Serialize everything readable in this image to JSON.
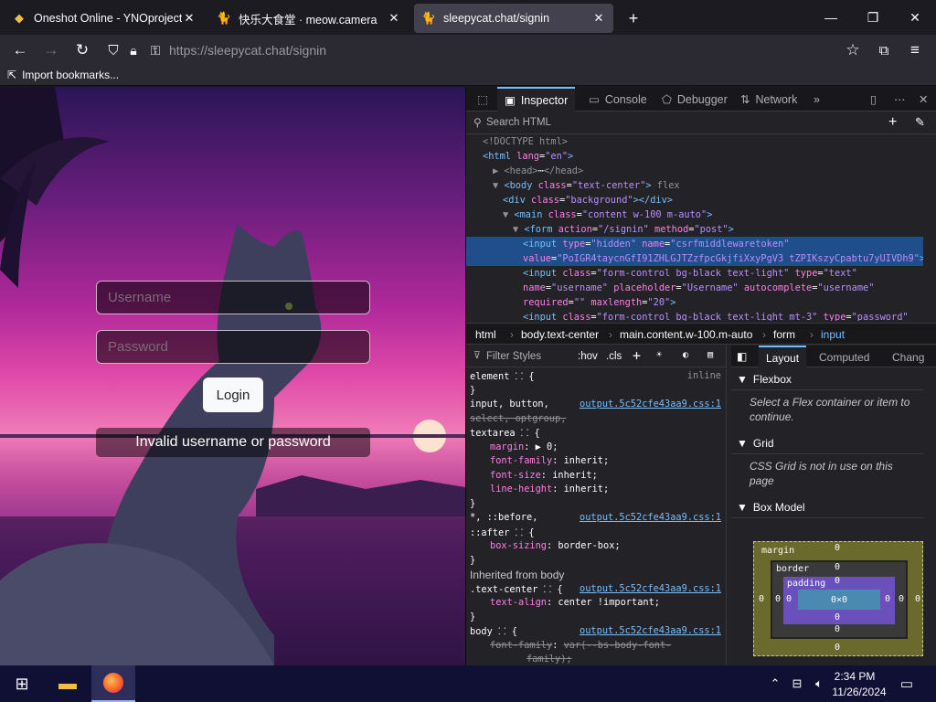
{
  "tabs": [
    {
      "title": "Oneshot Online - YNOproject",
      "icon": "niko-icon",
      "glyph": "🐱"
    },
    {
      "title": "快乐大食堂 · meow.camera",
      "icon": "cat-icon",
      "glyph": "🐈"
    },
    {
      "title": "sleepycat.chat/signin",
      "icon": "cat-icon",
      "glyph": "🐈"
    }
  ],
  "new_tab": "+",
  "window_controls": {
    "minimize": "—",
    "maximize": "❐",
    "close": "✕"
  },
  "nav": {
    "url_host": "https://sleepycat.chat",
    "url_path": "/signin"
  },
  "bookmarks": {
    "import_label": "Import bookmarks..."
  },
  "page": {
    "username_placeholder": "Username",
    "password_placeholder": "Password",
    "login_label": "Login",
    "error_text": "Invalid username or password"
  },
  "devtools": {
    "tabs": {
      "inspector": "Inspector",
      "console": "Console",
      "debugger": "Debugger",
      "network": "Network"
    },
    "search_placeholder": "Search HTML",
    "markup": [
      {
        "indent": 0,
        "parts": [
          [
            "cm",
            "<!DOCTYPE html>"
          ]
        ]
      },
      {
        "indent": 0,
        "parts": [
          [
            "tg",
            "<html "
          ],
          [
            "at",
            "lang"
          ],
          [
            "tx",
            "="
          ],
          [
            "av",
            "\"en\""
          ],
          [
            "tg",
            ">"
          ]
        ]
      },
      {
        "indent": 1,
        "parts": [
          [
            "cm",
            "▶ "
          ],
          [
            "cm",
            "<head>"
          ],
          [
            "tx",
            "⋯"
          ],
          [
            "cm",
            "</head>"
          ]
        ]
      },
      {
        "indent": 1,
        "parts": [
          [
            "cm",
            "▼ "
          ],
          [
            "tg",
            "<body "
          ],
          [
            "at",
            "class"
          ],
          [
            "tx",
            "="
          ],
          [
            "av",
            "\"text-center\""
          ],
          [
            "tg",
            ">"
          ],
          [
            "cm",
            "  flex"
          ]
        ]
      },
      {
        "indent": 2,
        "parts": [
          [
            "tg",
            "<div "
          ],
          [
            "at",
            "class"
          ],
          [
            "tx",
            "="
          ],
          [
            "av",
            "\"background\""
          ],
          [
            "tg",
            "></div>"
          ]
        ]
      },
      {
        "indent": 2,
        "parts": [
          [
            "cm",
            "▼ "
          ],
          [
            "tg",
            "<main "
          ],
          [
            "at",
            "class"
          ],
          [
            "tx",
            "="
          ],
          [
            "av",
            "\"content w-100 m-auto\""
          ],
          [
            "tg",
            ">"
          ]
        ]
      },
      {
        "indent": 3,
        "parts": [
          [
            "cm",
            "▼ "
          ],
          [
            "tg",
            "<form "
          ],
          [
            "at",
            "action"
          ],
          [
            "tx",
            "="
          ],
          [
            "av",
            "\"/signin\""
          ],
          [
            "tx",
            " "
          ],
          [
            "at",
            "method"
          ],
          [
            "tx",
            "="
          ],
          [
            "av",
            "\"post\""
          ],
          [
            "tg",
            ">"
          ]
        ]
      },
      {
        "indent": 4,
        "sel": true,
        "parts": [
          [
            "tg",
            "<input "
          ],
          [
            "at",
            "type"
          ],
          [
            "tx",
            "="
          ],
          [
            "av",
            "\"hidden\""
          ],
          [
            "tx",
            " "
          ],
          [
            "at",
            "name"
          ],
          [
            "tx",
            "="
          ],
          [
            "av",
            "\"csrfmiddlewaretoken\""
          ]
        ]
      },
      {
        "indent": 4,
        "sel": true,
        "parts": [
          [
            "at",
            "value"
          ],
          [
            "tx",
            "="
          ],
          [
            "av",
            "\"PoIGR4taycnGfI91ZHLGJTZzfpcGkjfiXxyPgV3 tZPIKszyCpabtu7yUIVDh9\""
          ],
          [
            "tg",
            ">"
          ]
        ]
      },
      {
        "indent": 4,
        "parts": [
          [
            "tg",
            "<input "
          ],
          [
            "at",
            "class"
          ],
          [
            "tx",
            "="
          ],
          [
            "av",
            "\"form-control bg-black text-light\""
          ],
          [
            "tx",
            " "
          ],
          [
            "at",
            "type"
          ],
          [
            "tx",
            "="
          ],
          [
            "av",
            "\"text\""
          ]
        ]
      },
      {
        "indent": 4,
        "parts": [
          [
            "at",
            "name"
          ],
          [
            "tx",
            "="
          ],
          [
            "av",
            "\"username\""
          ],
          [
            "tx",
            " "
          ],
          [
            "at",
            "placeholder"
          ],
          [
            "tx",
            "="
          ],
          [
            "av",
            "\"Username\""
          ],
          [
            "tx",
            " "
          ],
          [
            "at",
            "autocomplete"
          ],
          [
            "tx",
            "="
          ],
          [
            "av",
            "\"username\""
          ]
        ]
      },
      {
        "indent": 4,
        "parts": [
          [
            "at",
            "required"
          ],
          [
            "tx",
            "="
          ],
          [
            "av",
            "\"\""
          ],
          [
            "tx",
            " "
          ],
          [
            "at",
            "maxlength"
          ],
          [
            "tx",
            "="
          ],
          [
            "av",
            "\"20\""
          ],
          [
            "tg",
            ">"
          ]
        ]
      },
      {
        "indent": 4,
        "parts": [
          [
            "tg",
            "<input "
          ],
          [
            "at",
            "class"
          ],
          [
            "tx",
            "="
          ],
          [
            "av",
            "\"form-control bg-black text-light mt-3\""
          ],
          [
            "tx",
            " "
          ],
          [
            "at",
            "type"
          ],
          [
            "tx",
            "="
          ],
          [
            "av",
            "\"password\""
          ]
        ]
      }
    ],
    "breadcrumbs": [
      "html",
      "body.text-center",
      "main.content.w-100.m-auto",
      "form",
      "input"
    ],
    "filter_styles": "Filter Styles",
    "hov": ":hov",
    "cls": ".cls",
    "layout_tabs": {
      "layout": "Layout",
      "computed": "Computed",
      "changes": "Chang"
    },
    "rules": [
      {
        "sel": "element ⸬ {",
        "src": "inline"
      },
      {
        "close": "}"
      },
      {
        "sel": "input, button,",
        "src": "output.5c52cfe43aa9.css:1",
        "strike_part": "button"
      },
      {
        "sel": "select, optgroup,",
        "strike": true
      },
      {
        "sel": "textarea ⸬ {",
        "strike_word": "textarea"
      },
      {
        "prop": "margin",
        "val": "▶ 0;"
      },
      {
        "prop": "font-family",
        "val": "inherit;"
      },
      {
        "prop": "font-size",
        "val": "inherit;"
      },
      {
        "prop": "line-height",
        "val": "inherit;"
      },
      {
        "close": "}"
      },
      {
        "sel": "*, ::before,",
        "src": "output.5c52cfe43aa9.css:1"
      },
      {
        "sel": "::after ⸬ {",
        "strike_word": "::after"
      },
      {
        "prop": "box-sizing",
        "val": "border-box;"
      },
      {
        "close": "}"
      },
      {
        "heading": "Inherited from body"
      },
      {
        "sel": ".text-center ⸬ {",
        "src": "output.5c52cfe43aa9.css:1"
      },
      {
        "prop": "text-align",
        "val": "center !important;"
      },
      {
        "close": "}"
      },
      {
        "sel": "body ⸬ {",
        "src": "output.5c52cfe43aa9.css:1"
      },
      {
        "prop": "font-family",
        "val": "var(--bs-body-font-",
        "strike": true
      },
      {
        "val": "family);",
        "strike": true
      }
    ],
    "flexbox": {
      "title": "Flexbox",
      "note": "Select a Flex container or item to continue."
    },
    "grid": {
      "title": "Grid",
      "note": "CSS Grid is not in use on this page"
    },
    "boxmodel": {
      "title": "Box Model",
      "margin": "margin",
      "border": "border",
      "padding": "padding",
      "content": "0×0",
      "zero": "0"
    }
  },
  "taskbar": {
    "time": "2:34 PM",
    "date": "11/26/2024"
  }
}
